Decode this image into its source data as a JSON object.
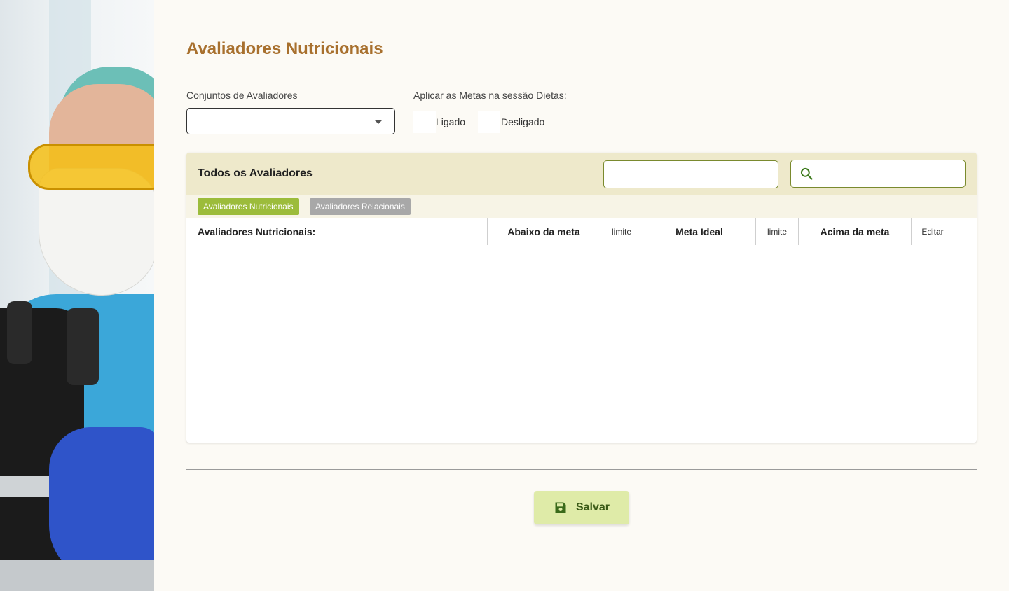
{
  "page": {
    "title": "Avaliadores Nutricionais"
  },
  "filters": {
    "conjuntos_label": "Conjuntos de Avaliadores",
    "conjuntos_value": "",
    "metas_label": "Aplicar as Metas na sessão Dietas:",
    "options": [
      "Ligado",
      "Desligado"
    ]
  },
  "panel": {
    "title": "Todos os Avaliadores",
    "filter_input_value": "",
    "search_input_value": "",
    "tabs": [
      "Avaliadores Nutricionais",
      "Avaliadores Relacionais"
    ],
    "columns": [
      "Avaliadores Nutricionais:",
      "Abaixo da meta",
      "limite",
      "Meta Ideal",
      "limite",
      "Acima da meta",
      "Editar"
    ],
    "rows": []
  },
  "actions": {
    "save_label": "Salvar"
  },
  "colors": {
    "title": "#a8702e",
    "header_bg": "#eee9cb",
    "tab_active": "#9cbc3b",
    "tab_inactive": "#a8a8a8",
    "save_bg": "#dfeba8",
    "save_text": "#3a5a16",
    "input_border": "#7a8a2e"
  },
  "icons": {
    "dropdown": "chevron-down-icon",
    "search": "search-icon",
    "save": "floppy-disk-icon"
  }
}
